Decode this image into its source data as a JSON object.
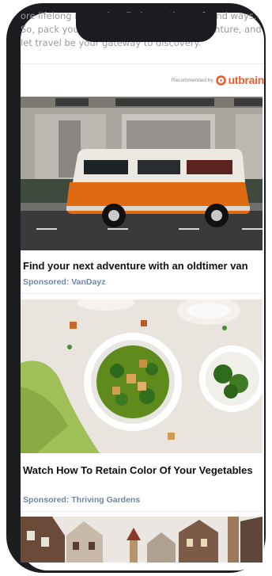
{
  "article": {
    "intro": "ore lifelong memories. Embrace the profound ways. So, pack your bags, set out on a new adventure, and let travel be your gateway to discovery."
  },
  "widget": {
    "recommended_by": "Recommended by",
    "brand": "utbrain",
    "brand_color": "#f25a29"
  },
  "cards": [
    {
      "title": "Find your next adventure with an oldtimer van",
      "sponsor": "Sponsored: VanDayz"
    },
    {
      "title": "Watch How To Retain Color Of Your Vegetables",
      "sponsor": "Sponsored: Thriving Gardens"
    }
  ]
}
